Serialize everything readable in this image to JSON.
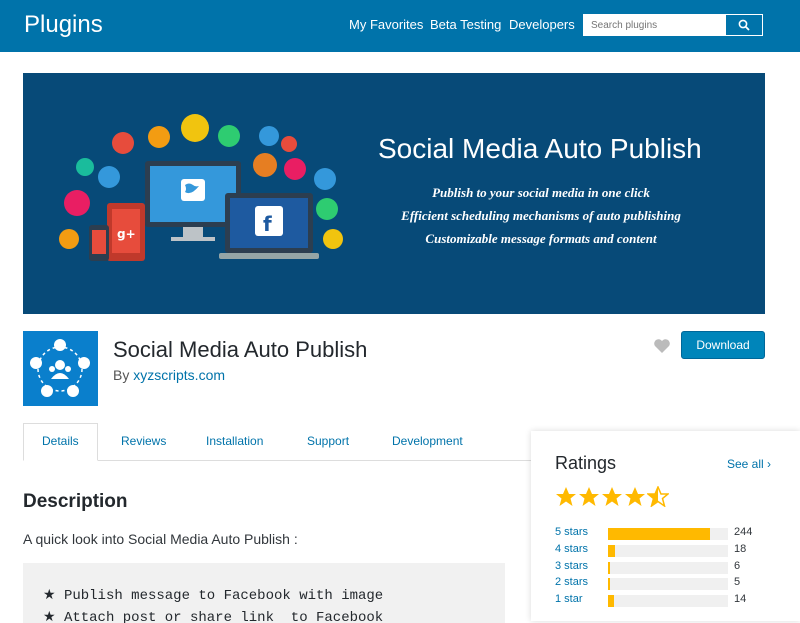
{
  "header": {
    "brand": "Plugins",
    "nav": [
      "My Favorites",
      "Beta Testing",
      "Developers"
    ],
    "search_placeholder": "Search plugins"
  },
  "banner": {
    "title": "Social Media Auto Publish",
    "lines": [
      "Publish to your  social media in one click",
      "Efficient scheduling mechanisms of auto publishing",
      "Customizable message formats and content"
    ]
  },
  "plugin": {
    "name": "Social Media Auto Publish",
    "by_prefix": "By ",
    "author": "xyzscripts.com",
    "download_label": "Download"
  },
  "tabs": [
    "Details",
    "Reviews",
    "Installation",
    "Support",
    "Development"
  ],
  "active_tab": "Details",
  "description": {
    "heading": "Description",
    "intro": "A quick look into Social Media Auto Publish :",
    "code_lines": [
      "★ Publish message to Facebook with image",
      "★ Attach post or share link  to Facebook"
    ]
  },
  "ratings": {
    "heading": "Ratings",
    "see_all": "See all",
    "stars_value": 4.5,
    "rows": [
      {
        "label": "5 stars",
        "count": "244",
        "fraction": 0.85
      },
      {
        "label": "4 stars",
        "count": "18",
        "fraction": 0.06
      },
      {
        "label": "3 stars",
        "count": "6",
        "fraction": 0.02
      },
      {
        "label": "2 stars",
        "count": "5",
        "fraction": 0.02
      },
      {
        "label": "1 star",
        "count": "14",
        "fraction": 0.05
      }
    ]
  },
  "colors": {
    "accent": "#0073aa",
    "star": "#ffb900",
    "banner_bg": "#074a78"
  }
}
